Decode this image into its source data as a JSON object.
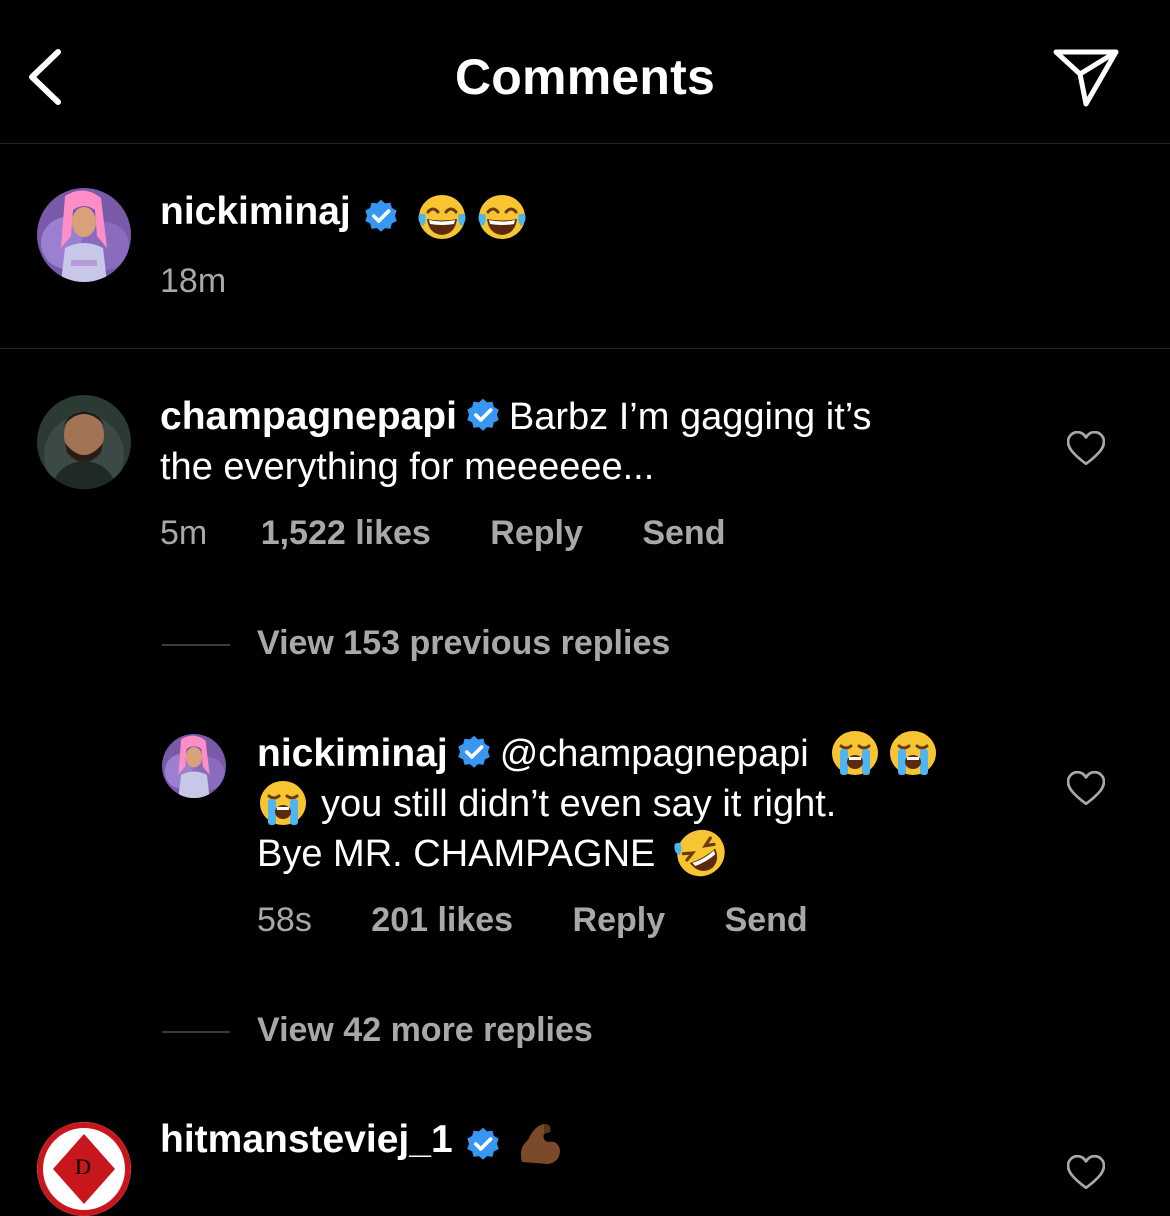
{
  "header": {
    "title": "Comments"
  },
  "colors": {
    "background": "#000000",
    "verified": "#3897f0",
    "secondary_text": "#a8a8a8",
    "divider": "#262626"
  },
  "caption": {
    "username": "nickiminaj",
    "verified": true,
    "text_emojis": [
      "face-with-tears-of-joy-emoji",
      "face-with-tears-of-joy-emoji"
    ],
    "time": "18m"
  },
  "comment1": {
    "username": "champagnepapi",
    "verified": true,
    "text_line1": "Barbz I’m gagging it’s",
    "text_line2": "the everything for meeeeee...",
    "time": "5m",
    "likes": "1,522 likes",
    "reply_label": "Reply",
    "send_label": "Send"
  },
  "view_previous": "View 153 previous replies",
  "reply1": {
    "username": "nickiminaj",
    "verified": true,
    "mention": "@champagnepapi",
    "text_line2": "you still didn’t even say it right.",
    "text_line3": "Bye MR. CHAMPAGNE",
    "emojis": [
      "loudly-crying-face-emoji",
      "loudly-crying-face-emoji",
      "loudly-crying-face-emoji",
      "rolling-on-floor-laughing-emoji"
    ],
    "time": "58s",
    "likes": "201 likes",
    "reply_label": "Reply",
    "send_label": "Send"
  },
  "view_more": "View 42 more replies",
  "comment2": {
    "username": "hitmansteviej_1",
    "verified": true,
    "emoji": "flexed-biceps-emoji"
  }
}
